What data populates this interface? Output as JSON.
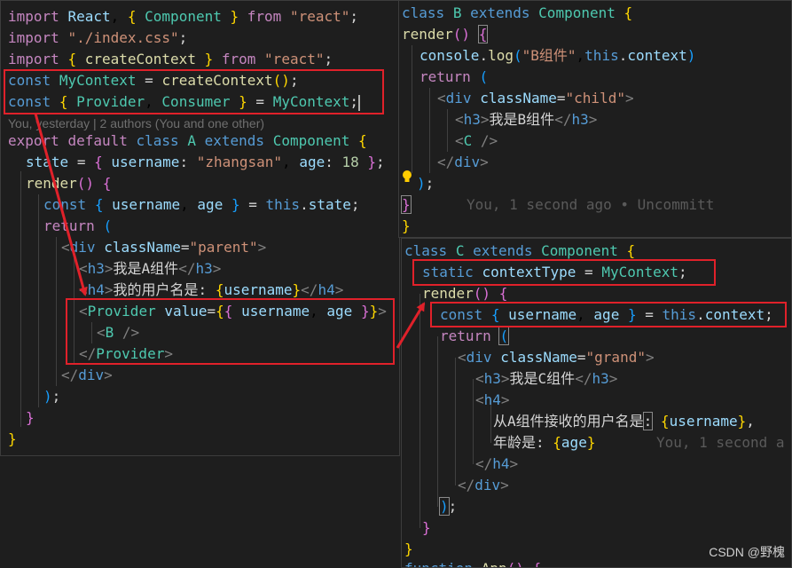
{
  "panelA": {
    "lines": [
      "import React, { Component } from \"react\";",
      "import \"./index.css\";",
      "import { createContext } from \"react\";",
      "const MyContext = createContext();",
      "const { Provider, Consumer } = MyContext;",
      "You, yesterday | 2 authors (You and one other)",
      "export default class A extends Component {",
      "state = { username: \"zhangsan\", age: 18 };",
      "render() {",
      "const { username, age } = this.state;",
      "return (",
      "<div className=\"parent\">",
      "<h3>我是A组件</h3>",
      "<h4>我的用户名是: {username}</h4>",
      "<Provider value={{ username, age }}>",
      "<B />",
      "</Provider>",
      "</div>",
      ");",
      "}",
      "}"
    ]
  },
  "panelB": {
    "lines": [
      "class B extends Component {",
      "render() {",
      "console.log(\"B组件\",this.context)",
      "return (",
      "<div className=\"child\">",
      "<h3>我是B组件</h3>",
      "<C />",
      "</div>",
      ");",
      "}",
      "}"
    ],
    "blame": "You, 1 second ago • Uncommitt"
  },
  "panelC": {
    "lines": [
      "class C extends Component {",
      "static contextType = MyContext;",
      "render() {",
      "const { username, age } = this.context;",
      "return (",
      "<div className=\"grand\">",
      "<h3>我是C组件</h3>",
      "<h4>",
      "从A组件接收的用户名是: {username},",
      "年龄是: {age}",
      "</h4>",
      "</div>",
      ");",
      "}",
      "}",
      "function App() {"
    ],
    "blame": "You, 1 second a"
  },
  "watermark": "CSDN @野槐",
  "colors": {
    "annotation": "#e0212a",
    "background": "#1e1e1e"
  }
}
